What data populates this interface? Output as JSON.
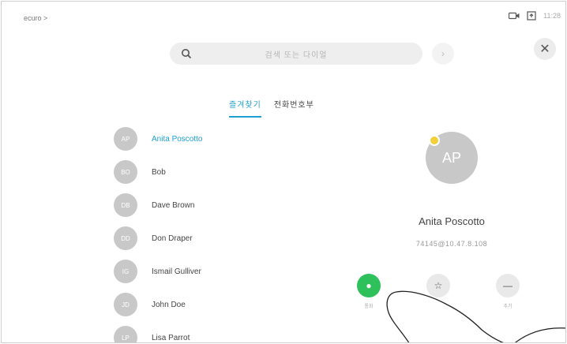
{
  "status_bar": {
    "device_name": "ecuro >",
    "clock": "11:28",
    "icons": [
      "camera-icon",
      "screen-share-icon"
    ]
  },
  "search": {
    "placeholder": "검색 또는 다이얼",
    "next_glyph": "›"
  },
  "close": {
    "glyph": "✕"
  },
  "tabs": [
    {
      "label": "즐겨찾기",
      "active": true
    },
    {
      "label": "전화번호부",
      "active": false
    }
  ],
  "contacts": [
    {
      "initials": "AP",
      "name": "Anita Poscotto",
      "selected": true
    },
    {
      "initials": "BO",
      "name": "Bob",
      "selected": false
    },
    {
      "initials": "DB",
      "name": "Dave Brown",
      "selected": false
    },
    {
      "initials": "DD",
      "name": "Don Draper",
      "selected": false
    },
    {
      "initials": "IG",
      "name": "Ismail Gulliver",
      "selected": false
    },
    {
      "initials": "JD",
      "name": "John Doe",
      "selected": false
    },
    {
      "initials": "LP",
      "name": "Lisa Parrot",
      "selected": false
    }
  ],
  "detail": {
    "initials": "AP",
    "name": "Anita Poscotto",
    "address": "74145@10.47.8.108"
  },
  "actions": [
    {
      "label": "통화",
      "glyph": "●",
      "kind": "call"
    },
    {
      "label": "",
      "glyph": "☆",
      "kind": "favorite"
    },
    {
      "label": "추가",
      "glyph": "—",
      "kind": "more"
    }
  ],
  "colors": {
    "accent": "#1e9fd1",
    "call_green": "#2ec05b",
    "avatar_gray": "#c8c8c8",
    "favorite_yellow": "#f2d03a"
  }
}
